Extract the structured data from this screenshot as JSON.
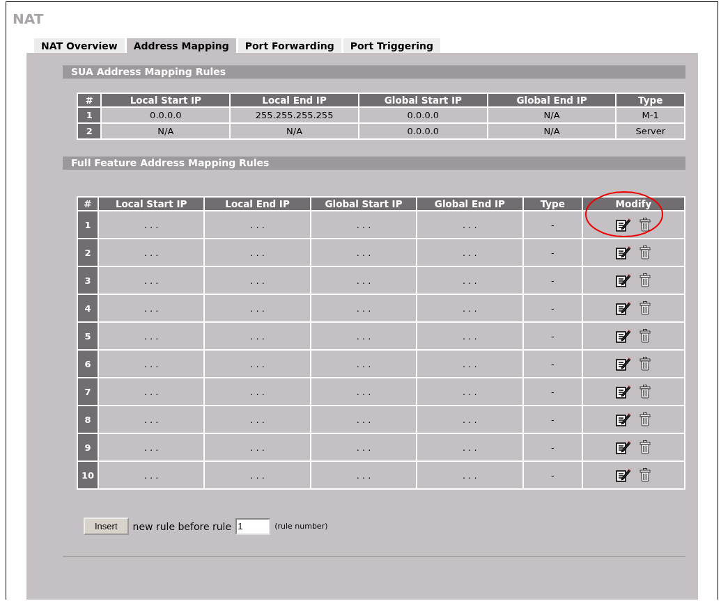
{
  "title": "NAT",
  "tabs": [
    {
      "label": "NAT Overview",
      "selected": false
    },
    {
      "label": "Address Mapping",
      "selected": true
    },
    {
      "label": "Port Forwarding",
      "selected": false
    },
    {
      "label": "Port Triggering",
      "selected": false
    }
  ],
  "sua_section": {
    "title": "SUA Address Mapping Rules",
    "columns": [
      "#",
      "Local Start IP",
      "Local End IP",
      "Global Start IP",
      "Global End IP",
      "Type"
    ],
    "rows": [
      [
        "1",
        "0.0.0.0",
        "255.255.255.255",
        "0.0.0.0",
        "N/A",
        "M-1"
      ],
      [
        "2",
        "N/A",
        "N/A",
        "0.0.0.0",
        "N/A",
        "Server"
      ]
    ]
  },
  "full_section": {
    "title": "Full Feature Address Mapping Rules",
    "columns": [
      "#",
      "Local Start IP",
      "Local End IP",
      "Global Start IP",
      "Global End IP",
      "Type",
      "Modify"
    ],
    "rows": [
      {
        "cells": [
          "1",
          ". . .",
          ". . .",
          ". . .",
          ". . .",
          "-"
        ],
        "circled": true
      },
      {
        "cells": [
          "2",
          ". . .",
          ". . .",
          ". . .",
          ". . .",
          "-"
        ],
        "circled": false
      },
      {
        "cells": [
          "3",
          ". . .",
          ". . .",
          ". . .",
          ". . .",
          "-"
        ],
        "circled": false
      },
      {
        "cells": [
          "4",
          ". . .",
          ". . .",
          ". . .",
          ". . .",
          "-"
        ],
        "circled": false
      },
      {
        "cells": [
          "5",
          ". . .",
          ". . .",
          ". . .",
          ". . .",
          "-"
        ],
        "circled": false
      },
      {
        "cells": [
          "6",
          ". . .",
          ". . .",
          ". . .",
          ". . .",
          "-"
        ],
        "circled": false
      },
      {
        "cells": [
          "7",
          ". . .",
          ". . .",
          ". . .",
          ". . .",
          "-"
        ],
        "circled": false
      },
      {
        "cells": [
          "8",
          ". . .",
          ". . .",
          ". . .",
          ". . .",
          "-"
        ],
        "circled": false
      },
      {
        "cells": [
          "9",
          ". . .",
          ". . .",
          ". . .",
          ". . .",
          "-"
        ],
        "circled": false
      },
      {
        "cells": [
          "10",
          ". . .",
          ". . .",
          ". . .",
          ". . .",
          "-"
        ],
        "circled": false
      }
    ]
  },
  "insert": {
    "button": "Insert",
    "text": "new rule before rule",
    "value": "1",
    "hint": "(rule number)"
  }
}
